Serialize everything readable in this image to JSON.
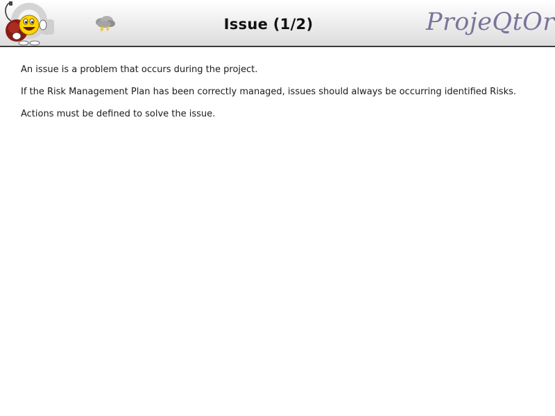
{
  "header": {
    "title": "Issue (1/2)",
    "brand": "ProjeQtOr",
    "left_logo_icon": "mascot-logo-icon",
    "status_icon": "storm-cloud-icon"
  },
  "content": {
    "paragraphs": [
      "An issue is a problem that occurs during the project.",
      "If the Risk Management Plan has been correctly managed, issues should always be occurring identified Risks.",
      "Actions must be defined to solve the issue."
    ]
  },
  "colors": {
    "brand": "#7c739c",
    "header_border": "#3a3a3a",
    "text": "#1a1a1a"
  }
}
